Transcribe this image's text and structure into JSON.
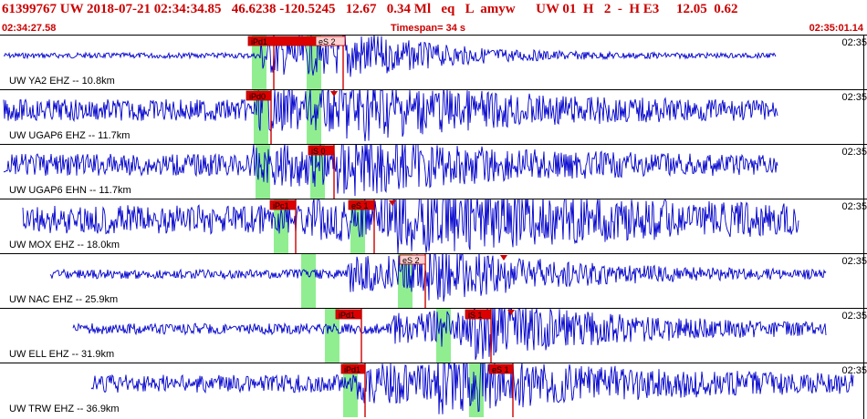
{
  "header": {
    "line": "61399767 UW 2018-07-21 02:34:34.85   46.6238 -120.5245   12.67   0.34 Ml   eq   L  amyw      UW 01  H   2  -  H E3     12.05  0.62",
    "start_time": "02:34:27.58",
    "timespan": "Timespan=  34 s",
    "end_time": "02:35:01.14"
  },
  "colors": {
    "waveform": "#0000cc",
    "pick": "#cc0000",
    "window": "#90ee90",
    "header": "#cc0000"
  },
  "traces": [
    {
      "label": "UW YA2 EHZ -- 10.8km",
      "tick": "02:35",
      "picks": [
        {
          "label": "iPd1",
          "box": true
        },
        {
          "label": "eS 2",
          "box": false
        }
      ]
    },
    {
      "label": "UW UGAP6 EHZ -- 11.7km",
      "tick": "02:35",
      "picks": [
        {
          "label": "iPd0",
          "box": true
        }
      ]
    },
    {
      "label": "UW UGAP6 EHN -- 11.7km",
      "tick": "02:35",
      "picks": [
        {
          "label": "iS 0",
          "box": true
        }
      ]
    },
    {
      "label": "UW MOX EHZ -- 18.0km",
      "tick": "02:35",
      "picks": [
        {
          "label": "iPc1",
          "box": true
        },
        {
          "label": "eS 1",
          "box": true
        }
      ]
    },
    {
      "label": "UW NAC EHZ -- 25.9km",
      "tick": "02:35",
      "picks": [
        {
          "label": "eS 2",
          "box": false
        }
      ]
    },
    {
      "label": "UW ELL EHZ -- 31.9km",
      "tick": "02:35",
      "picks": [
        {
          "label": "iPd1",
          "box": true
        },
        {
          "label": "iS 1",
          "box": true
        }
      ]
    },
    {
      "label": "UW TRW EHZ -- 36.9km",
      "tick": "02:35",
      "picks": [
        {
          "label": "iPd1",
          "box": true
        },
        {
          "label": "eS 1",
          "box": true
        }
      ]
    }
  ]
}
